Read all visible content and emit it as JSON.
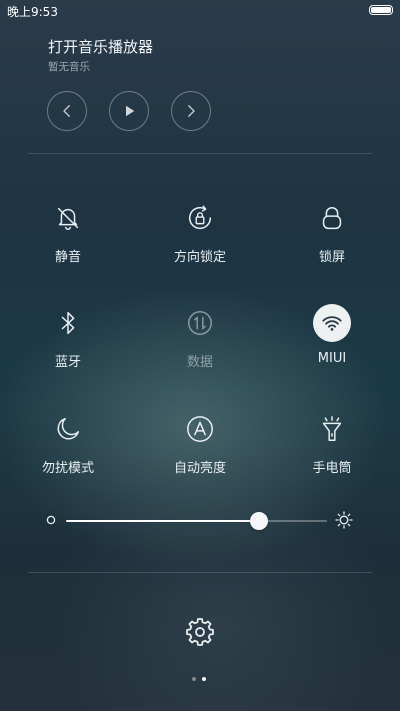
{
  "status_bar": {
    "time": "晚上9:53",
    "battery_icon": "battery-full-icon"
  },
  "music": {
    "title": "打开音乐播放器",
    "subtitle": "暂无音乐",
    "controls": [
      {
        "name": "previous-button",
        "icon": "chevron-left-icon"
      },
      {
        "name": "play-button",
        "icon": "play-icon"
      },
      {
        "name": "next-button",
        "icon": "chevron-right-icon"
      }
    ]
  },
  "toggles": [
    {
      "label": "静音",
      "icon": "bell-off-icon",
      "active": false,
      "enabled": true
    },
    {
      "label": "方向锁定",
      "icon": "rotation-lock-icon",
      "active": false,
      "enabled": true
    },
    {
      "label": "锁屏",
      "icon": "lock-icon",
      "active": false,
      "enabled": true
    },
    {
      "label": "蓝牙",
      "icon": "bluetooth-icon",
      "active": false,
      "enabled": true
    },
    {
      "label": "数据",
      "icon": "mobile-data-icon",
      "active": false,
      "enabled": false
    },
    {
      "label": "MIUI",
      "icon": "wifi-icon",
      "active": true,
      "enabled": true
    },
    {
      "label": "勿扰模式",
      "icon": "moon-icon",
      "active": false,
      "enabled": true
    },
    {
      "label": "自动亮度",
      "icon": "auto-brightness-icon",
      "active": false,
      "enabled": true
    },
    {
      "label": "手电筒",
      "icon": "flashlight-icon",
      "active": false,
      "enabled": true
    }
  ],
  "brightness": {
    "level": 0.74,
    "min_icon": "brightness-low-icon",
    "max_icon": "brightness-high-icon"
  },
  "settings": {
    "icon": "gear-icon"
  },
  "pager": {
    "count": 2,
    "active_index": 1
  },
  "colors": {
    "active_tile": "#eef1f2",
    "active_icon": "#2b3a44",
    "dot_active": "#ffffff",
    "dot_inactive": "rgba(255,255,255,0.4)"
  }
}
